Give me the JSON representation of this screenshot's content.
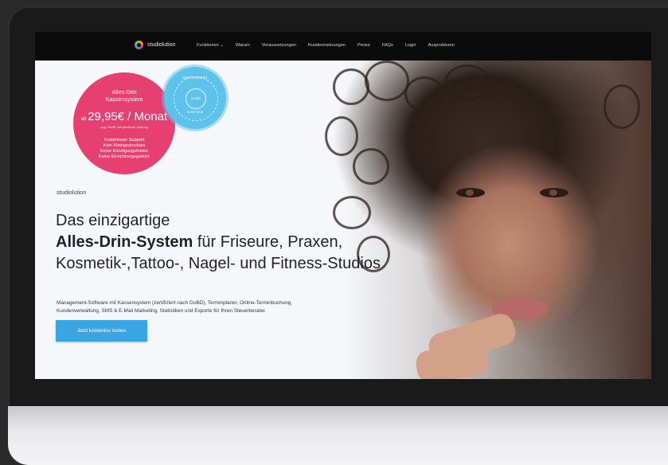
{
  "nav": {
    "brand": "studiolution",
    "links": [
      "Funktionen ⌄",
      "Warum",
      "Voraussetzungen",
      "Kundenmeinungen",
      "Preise",
      "FAQs",
      "Login",
      "Ausprobieren"
    ]
  },
  "pink_badge": {
    "title_line1": "Alles-Drin",
    "title_line2": "Kassensystem",
    "price_prefix": "ab",
    "price": "29,95€ / Monat",
    "note": "zzgl. MwSt. bei jährlicher Zahlung",
    "features": [
      "Kostenloser Support",
      "Kein Kleingedrucktes",
      "Keine Kündigungsfristen",
      "Keine Einrichtungsgebühr"
    ]
  },
  "cert_badge": {
    "top": "ZERTIFIZIERT",
    "core": "GoBD",
    "bottom": "KONFORM"
  },
  "hero": {
    "brand_small": "studiolution",
    "headline_l1": "Das einzigartige",
    "headline_bold": "Alles-Drin-System",
    "headline_l2_rest": " für Friseure, Praxen,",
    "headline_l3": "Kosmetik-,Tattoo-, Nagel- und Fitness-Studios",
    "description_l1": "Management-Software mit Kassensystem (zertifiziert nach GoBD), Terminplaner, Online-Terminbuchung,",
    "description_l2": "Kundenverwaltung, SMS & E-Mail Marketing, Statistiken und Exporte für Ihren Steuerberater.",
    "cta": "Jetzt kostenlos testen"
  },
  "colors": {
    "accent_pink": "#e63f71",
    "cert_blue": "#5ec3ea",
    "cta_blue": "#3aa6e1",
    "navbar": "#0b0b0c"
  }
}
